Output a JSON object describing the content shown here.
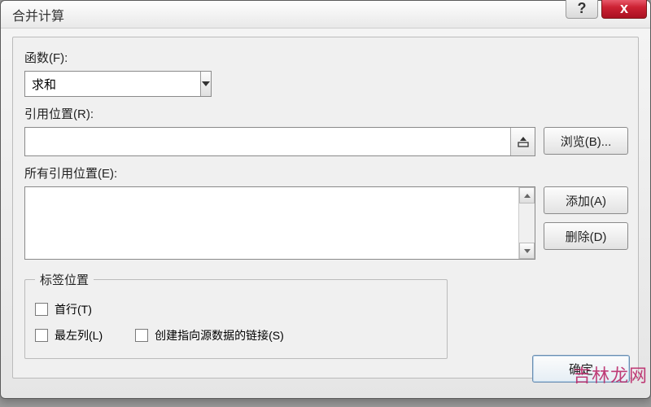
{
  "window": {
    "title": "合并计算"
  },
  "labels": {
    "function": "函数(F):",
    "reference": "引用位置(R):",
    "all_references": "所有引用位置(E):",
    "group_title": "标签位置",
    "top_row": "首行(T)",
    "left_column": "最左列(L)",
    "create_links": "创建指向源数据的链接(S)"
  },
  "values": {
    "function_selected": "求和",
    "reference_input": ""
  },
  "buttons": {
    "browse": "浏览(B)...",
    "add": "添加(A)",
    "delete": "删除(D)",
    "ok": "确定"
  },
  "watermark": "吉林龙网"
}
